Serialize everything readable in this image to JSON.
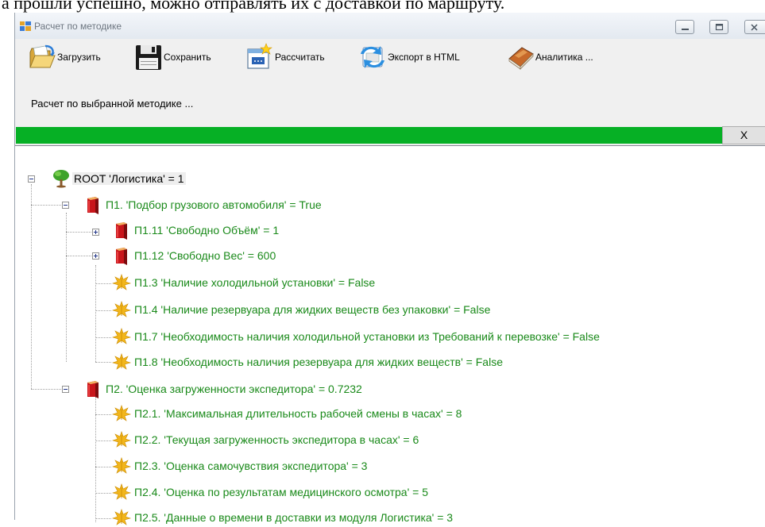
{
  "document": {
    "top_text": "а прошли успешно, можно отправлять их с доставкой по маршруту."
  },
  "window": {
    "title": "Расчет по методике"
  },
  "toolbar": {
    "load_label": "Загрузить",
    "save_label": "Сохранить",
    "calc_label": "Рассчитать",
    "export_label": "Экспорт в HTML",
    "analytics_label": "Аналитика ..."
  },
  "status": {
    "text": "Расчет по выбранной методике ...",
    "progress": 1.0,
    "close_label": "X",
    "progress_color": "#06b025"
  },
  "tree": {
    "root": "ROOT 'Логистика' = 1",
    "p1": "П1. 'Подбор грузового автомобиля' = True",
    "p1_11": "П1.11 'Свободно Объём' = 1",
    "p1_12": "П1.12 'Свободно Вес' = 600",
    "p1_3": "П1.3 'Наличие холодильной установки' = False",
    "p1_4": "П1.4 'Наличие резервуара для жидких веществ без упаковки' = False",
    "p1_7": "П1.7 'Необходимость наличия холодильной установки из Требований к перевозке' = False",
    "p1_8": "П1.8 'Необходимость наличия резервуара для жидких веществ' = False",
    "p2": "П2. 'Оценка загруженности экспедитора' = 0.7232",
    "p2_1": "П2.1. 'Максимальная длительность рабочей смены в часах' = 8",
    "p2_2": "П2.2. 'Текущая загруженность экспедитора в часах' = 6",
    "p2_3": "П2.3. 'Оценка самочувствия экспедитора' = 3",
    "p2_4": "П2.4. 'Оценка по результатам медицинского осмотра' = 5",
    "p2_5": "П2.5. 'Данные о времени в доставки из модуля Логистика' = 3"
  },
  "colors": {
    "node_text": "#1a8a1a",
    "progress": "#06b025"
  }
}
